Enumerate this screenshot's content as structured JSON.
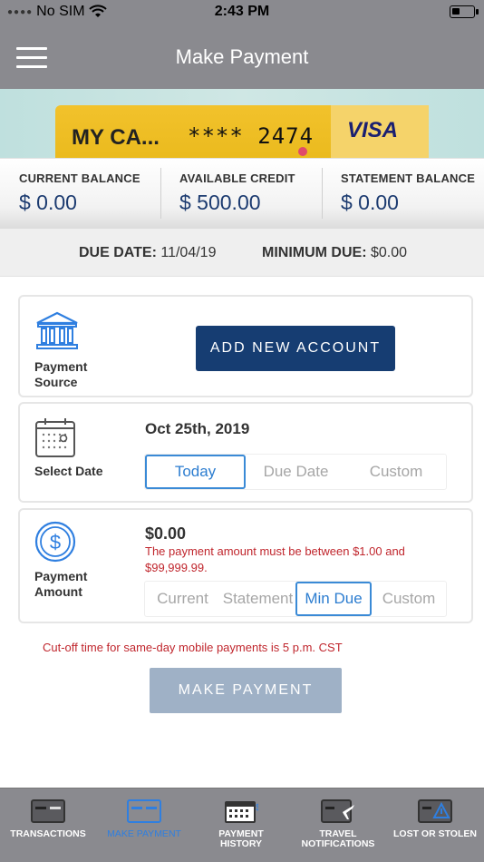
{
  "status_bar": {
    "carrier": "No SIM",
    "time": "2:43 PM",
    "icons": [
      "wifi-icon",
      "battery-icon"
    ]
  },
  "header": {
    "title": "Make Payment",
    "menu_icon": "hamburger-menu-icon"
  },
  "card": {
    "name": "MY CA...",
    "number": "**** 2474",
    "network": "VISA"
  },
  "balances": [
    {
      "label": "CURRENT BALANCE",
      "value": "$ 0.00"
    },
    {
      "label": "AVAILABLE CREDIT",
      "value": "$ 500.00"
    },
    {
      "label": "STATEMENT BALANCE",
      "value": "$ 0.00"
    }
  ],
  "due": {
    "due_date_label": "DUE DATE:",
    "due_date_value": "11/04/19",
    "min_due_label": "MINIMUM DUE:",
    "min_due_value": "$0.00"
  },
  "payment_source": {
    "label": "Payment Source",
    "icon": "bank-icon",
    "button": "ADD NEW ACCOUNT"
  },
  "select_date": {
    "label": "Select Date",
    "icon": "calendar-icon",
    "date": "Oct 25th, 2019",
    "options": [
      "Today",
      "Due Date",
      "Custom"
    ],
    "selected": "Today"
  },
  "payment_amount": {
    "label": "Payment Amount",
    "icon": "dollar-coin-icon",
    "amount": "$0.00",
    "error": "The payment amount must be between $1.00 and $99,999.99.",
    "options": [
      "Current",
      "Statement",
      "Min Due",
      "Custom"
    ],
    "selected": "Min Due"
  },
  "cutoff_note": "Cut-off time for same-day mobile payments is 5 p.m. CST",
  "make_payment_button": "MAKE PAYMENT",
  "tabbar": [
    {
      "label": "TRANSACTIONS",
      "icon": "card-icon",
      "active": false
    },
    {
      "label": "MAKE PAYMENT",
      "icon": "card-icon",
      "active": true
    },
    {
      "label": "PAYMENT HISTORY",
      "icon": "calendar-icon",
      "active": false
    },
    {
      "label": "TRAVEL NOTIFICATIONS",
      "icon": "card-plane-icon",
      "active": false
    },
    {
      "label": "LOST OR STOLEN",
      "icon": "card-alert-icon",
      "active": false
    }
  ],
  "colors": {
    "header": "#8a8a8f",
    "brand_navy": "#163d72",
    "accent_blue": "#3a8ad6",
    "error_red": "#c0262d",
    "disabled_button": "#9fb1c6",
    "card_gold": "#f2c22c"
  }
}
